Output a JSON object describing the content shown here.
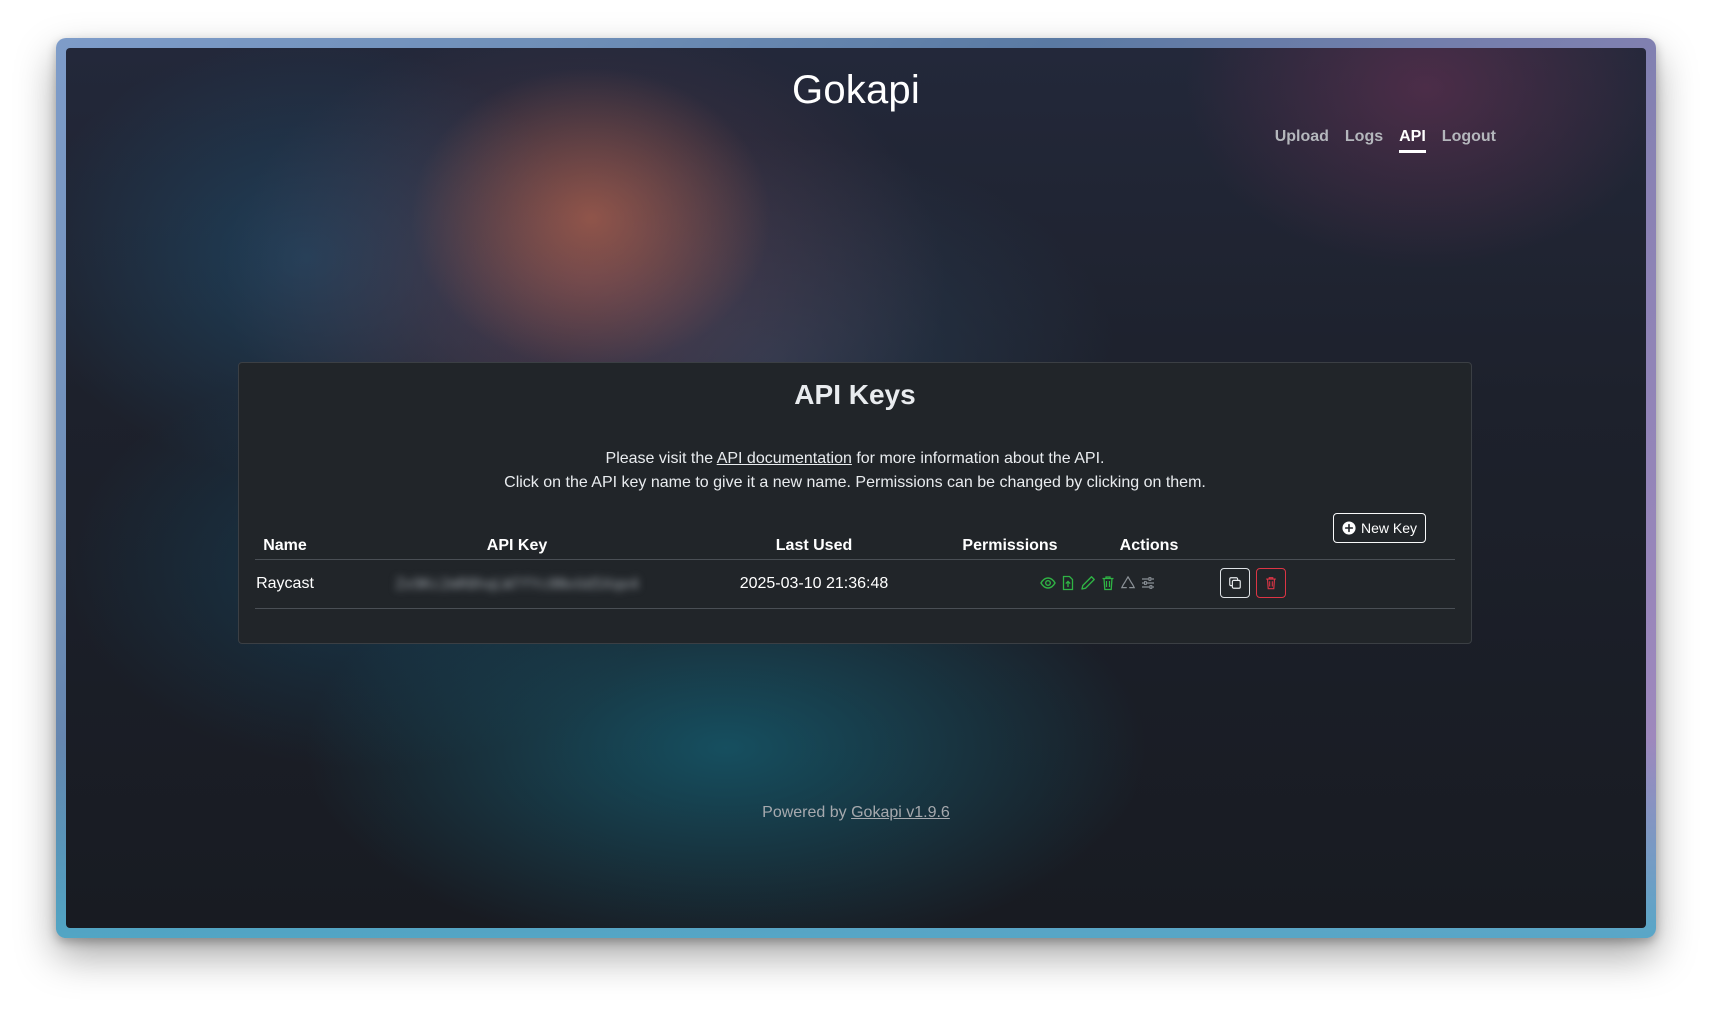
{
  "app": {
    "title": "Gokapi"
  },
  "nav": {
    "upload": "Upload",
    "logs": "Logs",
    "api": "API",
    "logout": "Logout",
    "active": "API"
  },
  "panel": {
    "title": "API Keys",
    "intro_before": "Please visit the ",
    "intro_link": "API documentation",
    "intro_after": " for more information about the API.",
    "intro_line2": "Click on the API key name to give it a new name. Permissions can be changed by clicking on them.",
    "new_key_label": "New Key"
  },
  "table": {
    "columns": [
      "Name",
      "API Key",
      "Last Used",
      "Permissions",
      "Actions"
    ],
    "rows": [
      {
        "name": "Raycast",
        "api_key": "Zx9Kc2mR8hqLW7fYc0NvUd5Xqe4",
        "last_used": "2025-03-10 21:36:48",
        "permissions": [
          {
            "icon": "eye-icon",
            "state": "granted",
            "color": "#2fb344"
          },
          {
            "icon": "file-upload-icon",
            "state": "granted",
            "color": "#2fb344"
          },
          {
            "icon": "pencil-icon",
            "state": "granted",
            "color": "#2fb344"
          },
          {
            "icon": "trash-icon",
            "state": "granted",
            "color": "#2fb344"
          },
          {
            "icon": "recycle-icon",
            "state": "denied",
            "color": "#6c757d"
          },
          {
            "icon": "sliders-icon",
            "state": "denied",
            "color": "#6c757d"
          }
        ]
      }
    ]
  },
  "footer": {
    "prefix": "Powered by ",
    "link": "Gokapi v1.9.6"
  },
  "colors": {
    "granted": "#2fb344",
    "denied": "#6c757d",
    "danger": "#dc3545",
    "panel_bg": "#212529"
  }
}
